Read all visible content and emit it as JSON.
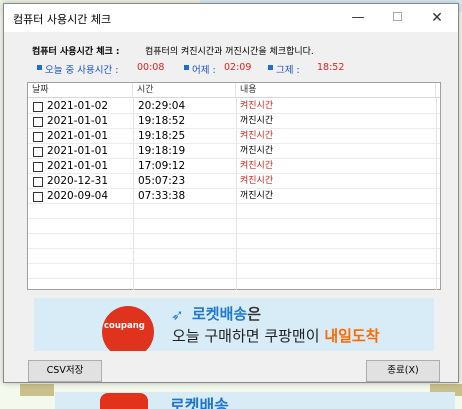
{
  "window": {
    "title": "컴퓨터 사용시간 체크"
  },
  "header": {
    "usage_label": "컴퓨터 사용시간 체크 :",
    "description": "컴퓨터의 켜진시간과 꺼진시간을 체크합니다."
  },
  "stats": {
    "today_label": "오늘 중 사용시간 :",
    "today_value": "00:08",
    "yesterday_label": "어제 :",
    "yesterday_value": "02:09",
    "day_before_label": "그제 :",
    "day_before_value": "18:52"
  },
  "table": {
    "columns": [
      "날짜",
      "시간",
      "내용"
    ],
    "rows": [
      {
        "date": "2021-01-02",
        "time": "20:29:04",
        "content": "켜진시간",
        "on": true
      },
      {
        "date": "2021-01-01",
        "time": "19:18:52",
        "content": "꺼진시간",
        "on": false
      },
      {
        "date": "2021-01-01",
        "time": "19:18:25",
        "content": "켜진시간",
        "on": true
      },
      {
        "date": "2021-01-01",
        "time": "19:18:19",
        "content": "꺼진시간",
        "on": false
      },
      {
        "date": "2021-01-01",
        "time": "17:09:12",
        "content": "켜진시간",
        "on": true
      },
      {
        "date": "2020-12-31",
        "time": "05:07:23",
        "content": "켜진시간",
        "on": true
      },
      {
        "date": "2020-09-04",
        "time": "07:33:38",
        "content": "꺼진시간",
        "on": false
      }
    ]
  },
  "ad": {
    "logo": "coupang",
    "line1_highlight": "로켓배송",
    "line1_suffix": "은",
    "line2_prefix": "오늘 구매하면 쿠팡맨이",
    "line2_highlight": "내일도착"
  },
  "buttons": {
    "csv": "CSV저장",
    "exit": "종료(X)"
  },
  "colors": {
    "on_color": "#e0221a",
    "off_color": "#000000",
    "stat_value": "#e0221a",
    "stat_label": "#1b52c4"
  }
}
